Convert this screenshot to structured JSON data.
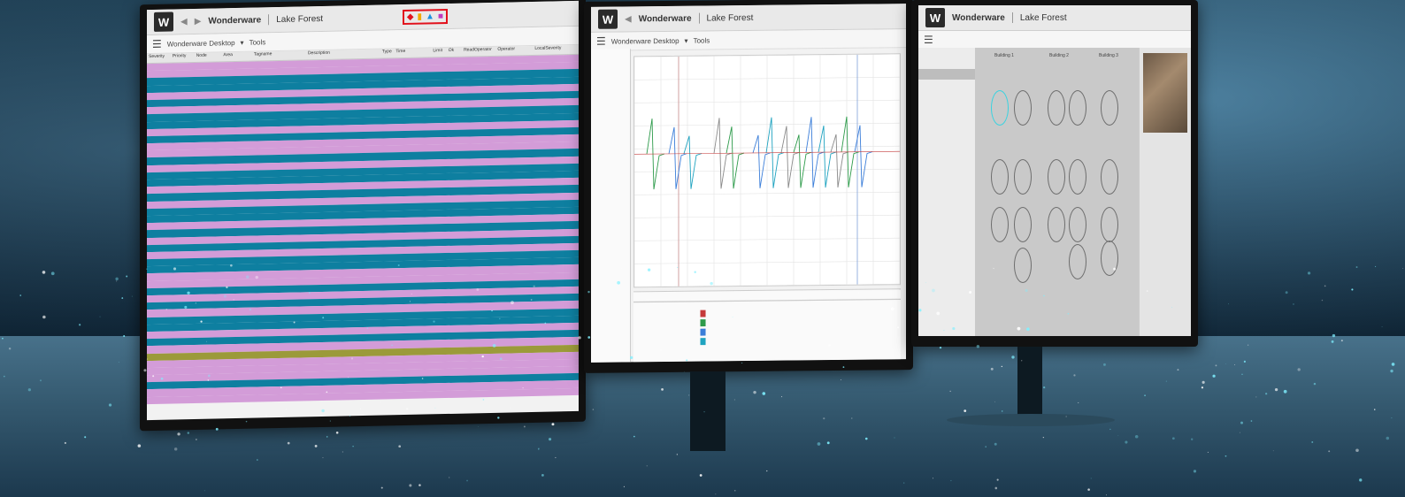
{
  "app": {
    "name": "Wonderware",
    "site": "Lake Forest"
  },
  "monitor1": {
    "toolbar": {
      "breadcrumb": "Wonderware Desktop",
      "tab": "Tools"
    },
    "columns": [
      "Severity",
      "Priority",
      "Node",
      "Area",
      "Tagname",
      "Description",
      "Type",
      "Time",
      "Limit",
      "Ok",
      "ReadOperator",
      "Operator",
      "LocalSeverity"
    ],
    "row_colors": [
      "#d39cd8",
      "#0e7fa0"
    ]
  },
  "monitor2": {
    "toolbar": {
      "breadcrumb": "Wonderware Desktop",
      "tab": "Tools"
    }
  },
  "monitor3": {
    "buildings": [
      "Building 1",
      "Building 2",
      "Building 3"
    ]
  },
  "colors": {
    "accent": "#39d3e0",
    "highlight_box": "#e2121d"
  }
}
